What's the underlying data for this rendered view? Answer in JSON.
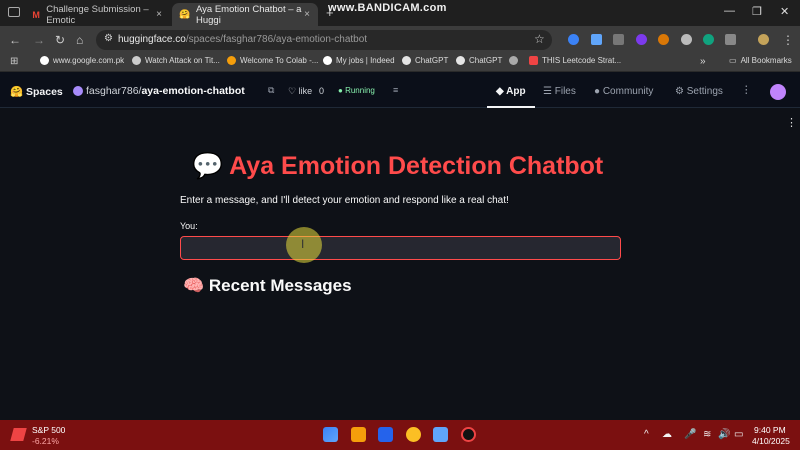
{
  "browser": {
    "tabs": [
      {
        "label": "Challenge Submission – Emotic",
        "close": "×"
      },
      {
        "label": "Aya Emotion Chatbot – a Huggi",
        "close": "×"
      }
    ],
    "new_tab": "+",
    "recorder_watermark": "www.BANDICAM.com",
    "url_host": "huggingface.co",
    "url_path": "/spaces/fasghar786/aya-emotion-chatbot",
    "bookmarks": [
      "www.google.com.pk",
      "Watch Attack on Tit...",
      "Welcome To Colab -...",
      "My jobs | Indeed",
      "ChatGPT",
      "ChatGPT",
      "THIS Leetcode Strat..."
    ],
    "bookmarks_overflow": "»",
    "all_bookmarks": "All Bookmarks"
  },
  "hf": {
    "spaces_label": "Spaces",
    "owner": "fasghar786/",
    "repo": "aya-emotion-chatbot",
    "like_label": "like",
    "like_count": "0",
    "status": "Running",
    "tabs": [
      "App",
      "Files",
      "Community",
      "Settings"
    ]
  },
  "app": {
    "title": "Aya Emotion Detection Chatbot",
    "title_icon": "💬",
    "description": "Enter a message, and I'll detect your emotion and respond like a real chat!",
    "input_label": "You:",
    "input_value": "",
    "recent_heading": "Recent Messages",
    "recent_icon": "🧠"
  },
  "taskbar": {
    "stock_name": "S&P 500",
    "stock_change": "-6.21%",
    "time": "9:40 PM",
    "date": "4/10/2025"
  },
  "colors": {
    "accent": "#ff4b4b",
    "background": "#0e1117",
    "taskbar": "#7b1010"
  }
}
